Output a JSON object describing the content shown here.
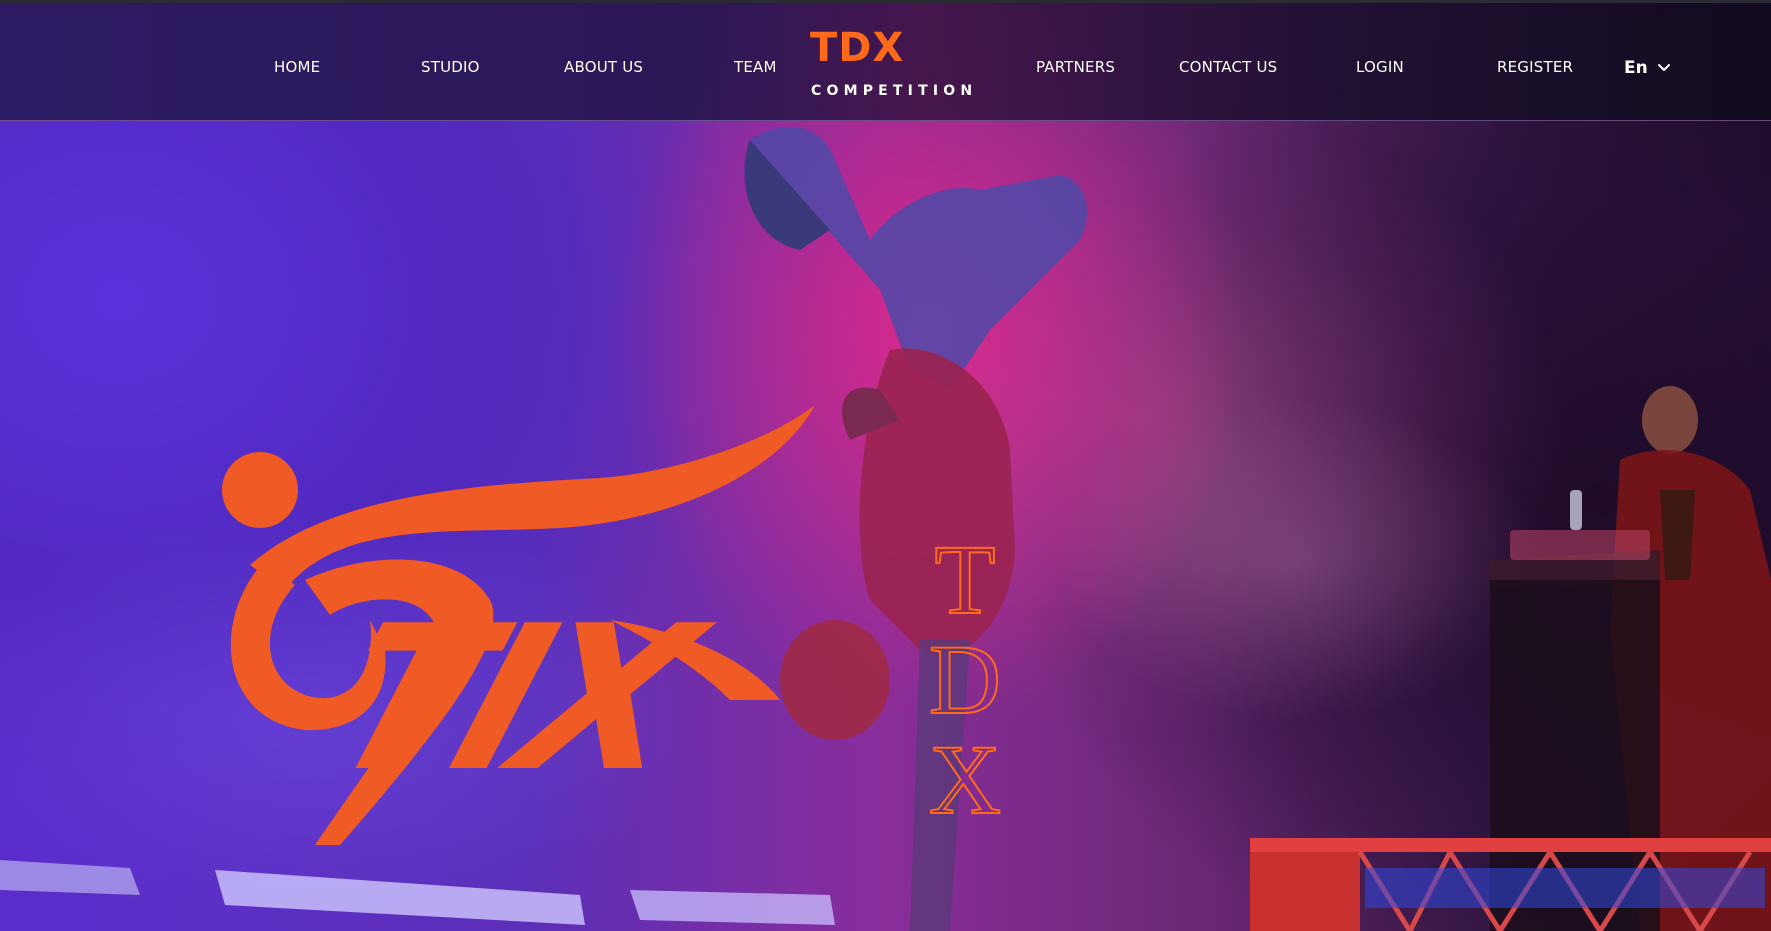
{
  "nav": {
    "items": [
      {
        "label": "HOME"
      },
      {
        "label": "STUDIO"
      },
      {
        "label": "ABOUT US"
      },
      {
        "label": "TEAM"
      },
      {
        "label": "PARTNERS"
      },
      {
        "label": "CONTACT US"
      },
      {
        "label": "LOGIN"
      },
      {
        "label": "REGISTER"
      }
    ],
    "language": "En",
    "language_icon": "chevron-down-icon"
  },
  "brand": {
    "title": "TDX",
    "subtitle": "COMPETITION"
  },
  "hero": {
    "logo_wordmark": "TIX",
    "logo_vertical": [
      "T",
      "D",
      "X"
    ]
  },
  "colors": {
    "accent": "#ff6a1a",
    "logo_orange": "#f05a24",
    "header_bg": "#2a1a5c",
    "nav_text": "#ffffff"
  }
}
